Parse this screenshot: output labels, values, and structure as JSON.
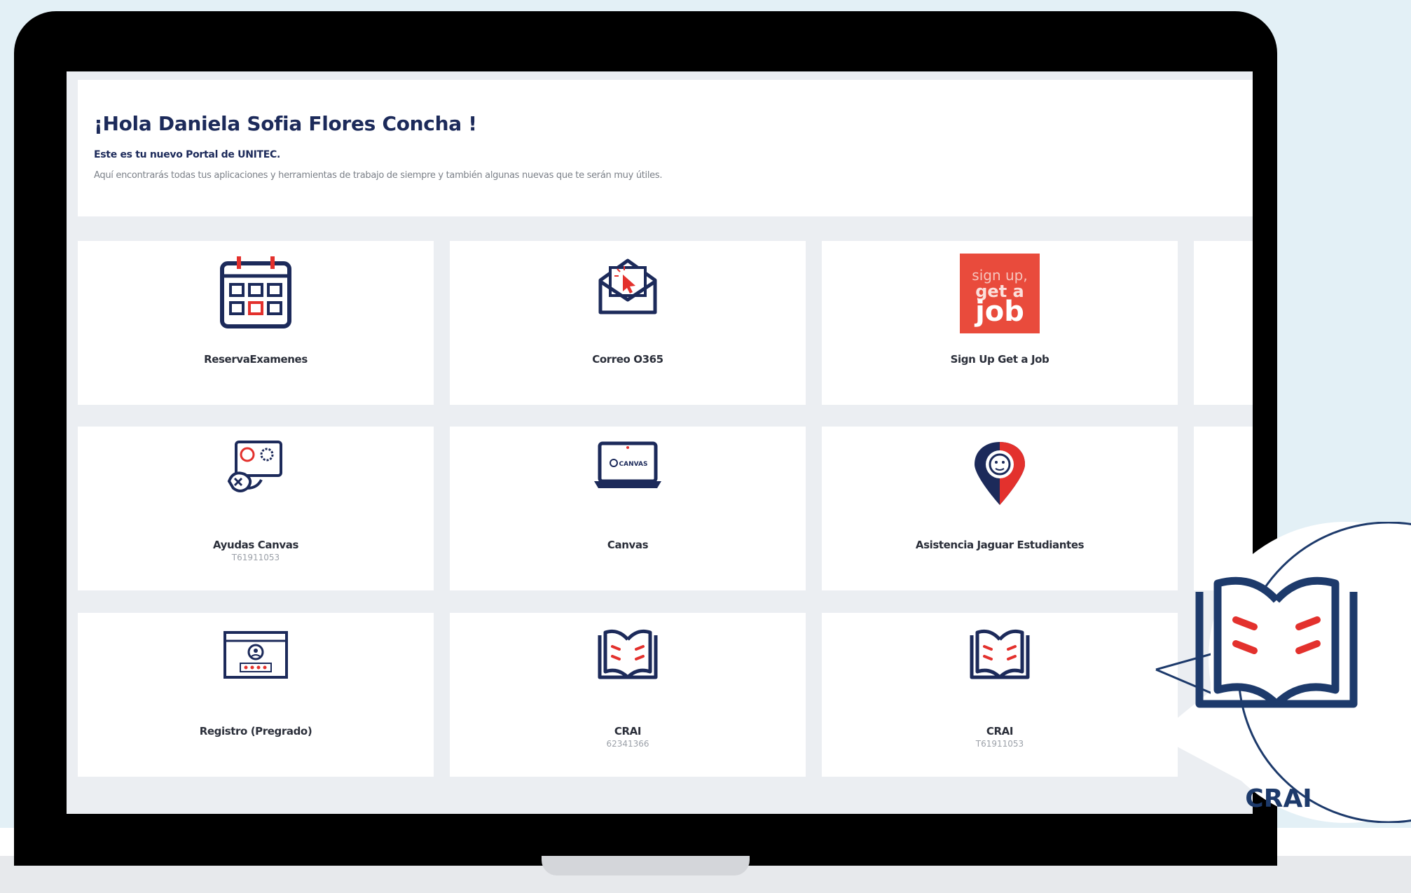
{
  "welcome": {
    "greeting": "¡Hola Daniela Sofia Flores Concha !",
    "subtitle": "Este es tu nuevo Portal de UNITEC.",
    "description": "Aquí encontrarás todas tus aplicaciones y herramientas de trabajo de siempre y también algunas nuevas que te serán muy útiles."
  },
  "apps": [
    {
      "label": "ReservaExamenes",
      "code": "",
      "icon": "calendar-icon"
    },
    {
      "label": "Correo O365",
      "code": "",
      "icon": "mail-envelope-icon"
    },
    {
      "label": "Sign Up Get a Job",
      "code": "",
      "icon": "signup-get-a-job-logo",
      "logo_text": "sign up, get a job"
    },
    {
      "label": "Ayudas Canvas",
      "code": "T61911053",
      "icon": "canvas-help-icon"
    },
    {
      "label": "Canvas",
      "code": "",
      "icon": "laptop-canvas-icon",
      "logo_text": "CANVAS"
    },
    {
      "label": "Asistencia Jaguar Estudiantes",
      "code": "",
      "icon": "jaguar-location-pin-icon"
    },
    {
      "label": "Registro (Pregrado)",
      "code": "",
      "icon": "login-registration-icon"
    },
    {
      "label": "CRAI",
      "code": "62341366",
      "icon": "open-book-icon"
    },
    {
      "label": "CRAI",
      "code": "T61911053",
      "icon": "open-book-icon"
    }
  ],
  "zoom_callout": {
    "label": "CRAI",
    "icon": "open-book-icon"
  },
  "colors": {
    "navy": "#1c2a5a",
    "accent_red": "#e3312d",
    "background": "#e3f0f6"
  }
}
